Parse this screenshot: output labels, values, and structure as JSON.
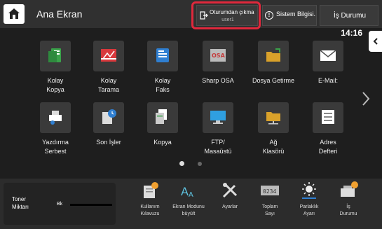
{
  "header": {
    "title": "Ana Ekran",
    "logout_label": "Oturumdan çıkma",
    "user_name": "user1",
    "system_info_label": "Sistem Bilgisi.",
    "job_status_label": "İş Durumu"
  },
  "clock": "14:16",
  "apps": [
    {
      "label1": "Kolay",
      "label2": "Kopya",
      "icon": "easy-copy-icon",
      "color": "#3aa24a"
    },
    {
      "label1": "Kolay",
      "label2": "Tarama",
      "icon": "easy-scan-icon",
      "color": "#d8383c"
    },
    {
      "label1": "Kolay",
      "label2": "Faks",
      "icon": "easy-fax-icon",
      "color": "#2f7fd1"
    },
    {
      "label1": "Sharp OSA",
      "label2": "",
      "icon": "sharp-osa-icon",
      "color": "#c43a3a"
    },
    {
      "label1": "Dosya Getirme",
      "label2": "",
      "icon": "file-retrieve-icon",
      "color": "#d9a12a"
    },
    {
      "label1": "E-Mail:",
      "label2": "",
      "icon": "email-icon",
      "color": "#ffffff"
    },
    {
      "label1": "Yazdırma",
      "label2": "Serbest",
      "icon": "print-release-icon",
      "color": "#ffffff"
    },
    {
      "label1": "Son İşler",
      "label2": "",
      "icon": "recent-jobs-icon",
      "color": "#2f7fd1"
    },
    {
      "label1": "Kopya",
      "label2": "",
      "icon": "copy-icon",
      "color": "#ffffff"
    },
    {
      "label1": "FTP/",
      "label2": "Masaüstü",
      "icon": "ftp-desktop-icon",
      "color": "#2f9fe0"
    },
    {
      "label1": "Ağ",
      "label2": "Klasörü",
      "icon": "network-folder-icon",
      "color": "#d9a12a"
    },
    {
      "label1": "Adres",
      "label2": "Defteri",
      "icon": "address-book-icon",
      "color": "#ffffff"
    }
  ],
  "pager": {
    "current": 1,
    "total": 2
  },
  "toner": {
    "title1": "Toner",
    "title2": "Miktarı",
    "color_label": "Bk"
  },
  "tools": [
    {
      "label1": "Kullanım",
      "label2": "Kılavuzu",
      "icon": "user-guide-icon"
    },
    {
      "label1": "Ekran Modunu",
      "label2": "büyült",
      "icon": "enlarge-display-icon"
    },
    {
      "label1": "Ayarlar",
      "label2": "",
      "icon": "settings-icon"
    },
    {
      "label1": "Toplam",
      "label2": "Sayı",
      "icon": "total-count-icon"
    },
    {
      "label1": "Parlaklık",
      "label2": "Ayarı",
      "icon": "brightness-icon"
    },
    {
      "label1": "İş",
      "label2": "Durumu",
      "icon": "job-status-icon"
    }
  ],
  "colors": {
    "highlight": "#e0283c",
    "accent_orange": "#f0a030"
  }
}
